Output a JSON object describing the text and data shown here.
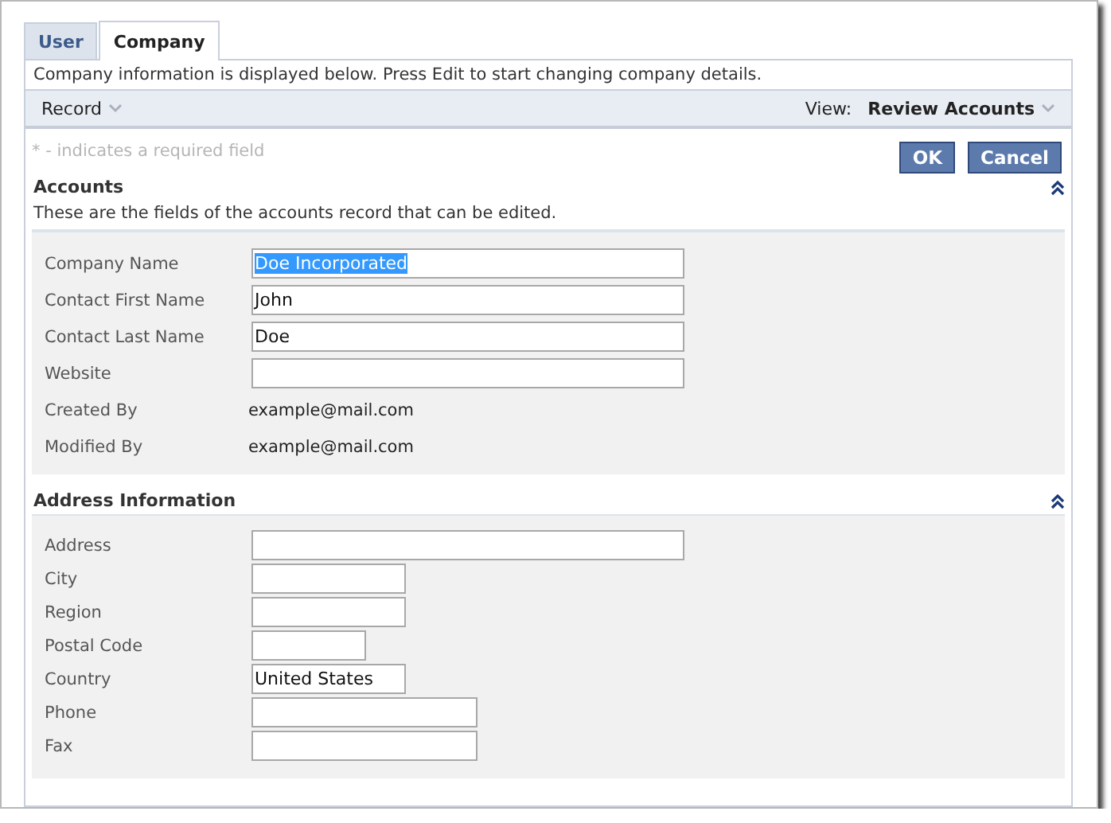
{
  "tabs": [
    {
      "label": "User",
      "selected": false
    },
    {
      "label": "Company",
      "selected": true
    }
  ],
  "description": "Company information is displayed below. Press Edit to start changing company details.",
  "toolbar": {
    "record_menu": "Record",
    "view_label": "View:",
    "view_value": "Review Accounts"
  },
  "required_note": "* - indicates a required field",
  "buttons": [
    "OK",
    "Cancel"
  ],
  "sections": [
    {
      "title": "Accounts",
      "description": "These are the fields of the accounts record that can be edited.",
      "expanded": true,
      "fields": [
        {
          "label": "Company Name",
          "kind": "input",
          "value": "Doe Incorporated",
          "text_selected": true
        },
        {
          "label": "Contact First Name",
          "kind": "input",
          "value": "John"
        },
        {
          "label": "Contact Last Name",
          "kind": "input",
          "value": "Doe"
        },
        {
          "label": "Website",
          "kind": "input"
        },
        {
          "label": "Created By",
          "kind": "readonly",
          "value": "example@mail.com"
        },
        {
          "label": "Modified By",
          "kind": "readonly",
          "value": "example@mail.com"
        }
      ]
    },
    {
      "title": "Address Information",
      "expanded": true,
      "fields": [
        {
          "label": "Address",
          "kind": "input"
        },
        {
          "label": "City",
          "kind": "input"
        },
        {
          "label": "Region",
          "kind": "input"
        },
        {
          "label": "Postal Code",
          "kind": "input"
        },
        {
          "label": "Country",
          "kind": "input",
          "value": "United States"
        },
        {
          "label": "Phone",
          "kind": "input"
        },
        {
          "label": "Fax",
          "kind": "input"
        }
      ]
    }
  ]
}
